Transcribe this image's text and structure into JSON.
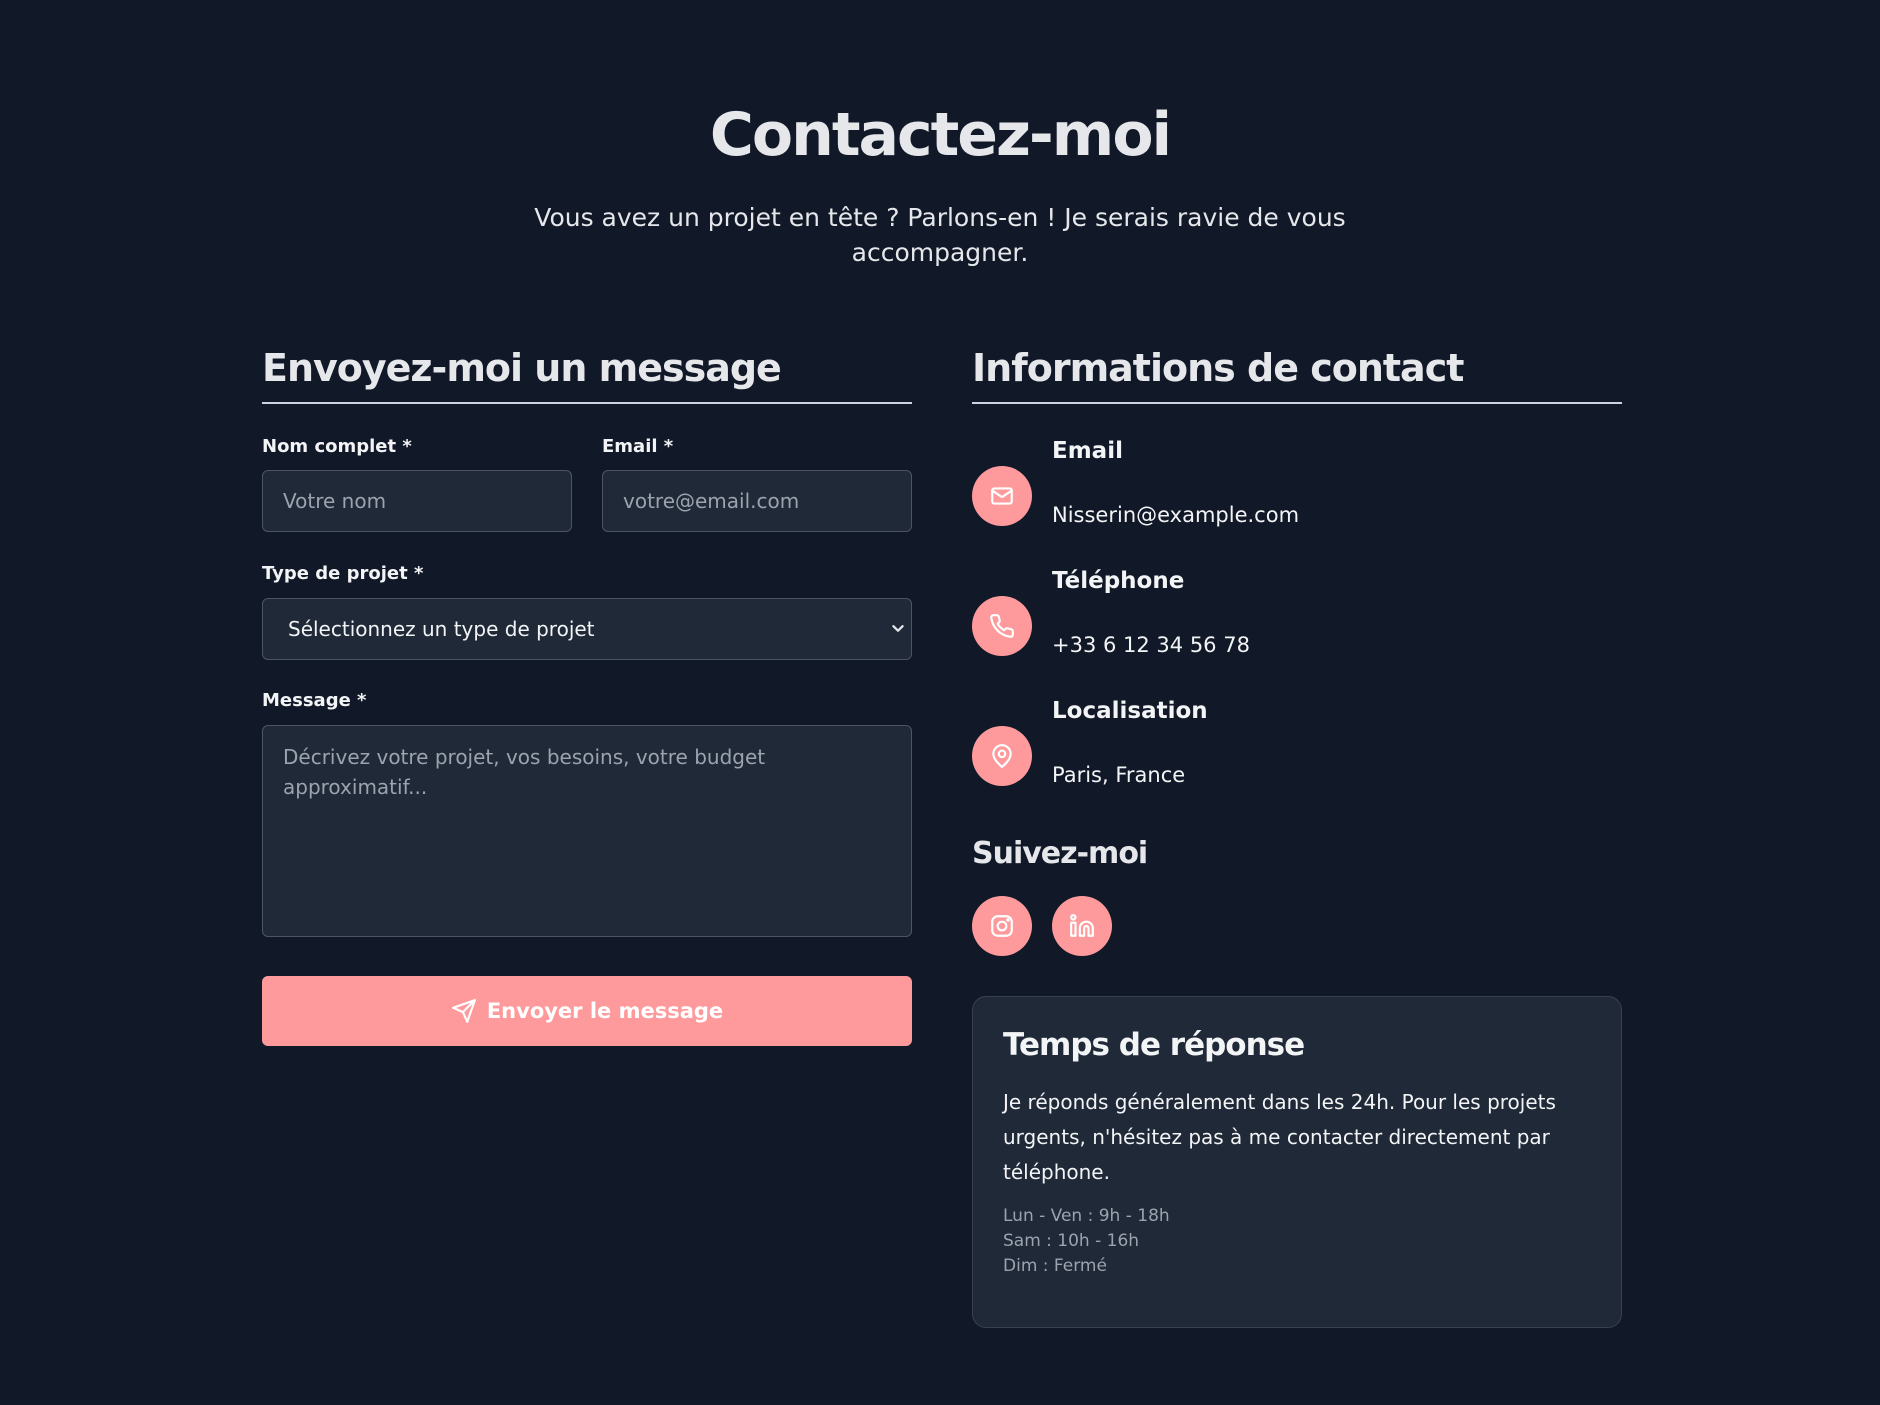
{
  "hero": {
    "title": "Contactez-moi",
    "subtitle": "Vous avez un projet en tête ? Parlons-en ! Je serais ravie de vous accompagner."
  },
  "form": {
    "title": "Envoyez-moi un message",
    "name_label": "Nom complet *",
    "name_placeholder": "Votre nom",
    "email_label": "Email *",
    "email_placeholder": "votre@email.com",
    "project_label": "Type de projet *",
    "project_selected": "Sélectionnez un type de projet",
    "message_label": "Message *",
    "message_placeholder": "Décrivez votre projet, vos besoins, votre budget approximatif...",
    "submit_label": "Envoyer le message",
    "submit_icon": "send-icon"
  },
  "contact": {
    "title": "Informations de contact",
    "items": [
      {
        "icon": "mail-icon",
        "label": "Email",
        "value": "Nisserin@example.com"
      },
      {
        "icon": "phone-icon",
        "label": "Téléphone",
        "value": "+33 6 12 34 56 78"
      },
      {
        "icon": "map-pin-icon",
        "label": "Localisation",
        "value": "Paris, France"
      }
    ],
    "follow_title": "Suivez-moi",
    "socials": [
      {
        "icon": "instagram-icon"
      },
      {
        "icon": "linkedin-icon"
      }
    ]
  },
  "response_card": {
    "title": "Temps de réponse",
    "text": "Je réponds généralement dans les 24h. Pour les projets urgents, n'hésitez pas à me contacter directement par téléphone.",
    "hours": [
      "Lun - Ven : 9h - 18h",
      "Sam : 10h - 16h",
      "Dim : Fermé"
    ]
  },
  "colors": {
    "background": "#111827",
    "surface": "#1f2937",
    "accent": "#fe9a9c",
    "text": "#e5e7eb",
    "muted": "#9ca3af"
  }
}
